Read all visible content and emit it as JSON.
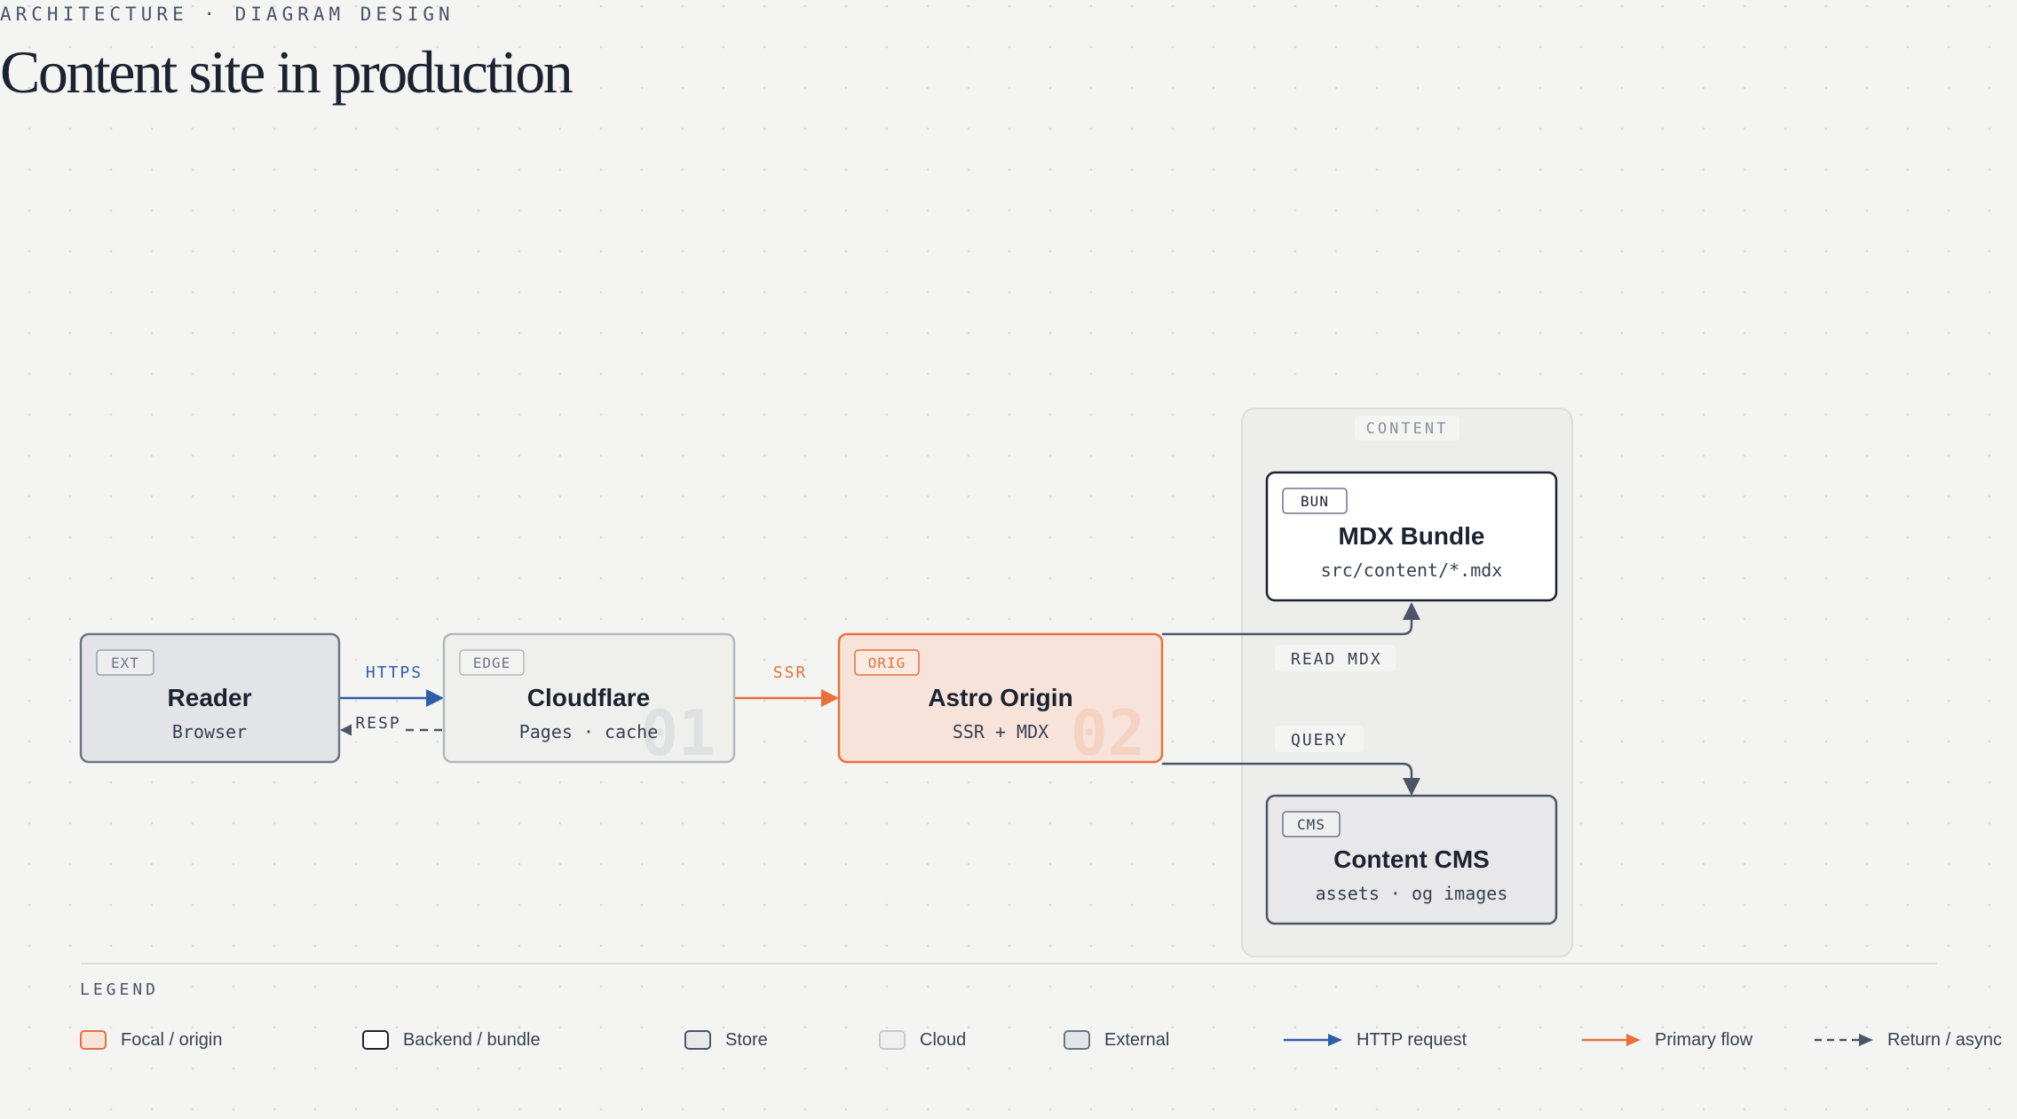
{
  "header": {
    "eyebrow": "ARCHITECTURE · DIAGRAM DESIGN",
    "title": "Content site in production"
  },
  "group": {
    "label": "CONTENT"
  },
  "nodes": {
    "reader": {
      "tag": "EXT",
      "title": "Reader",
      "subtitle": "Browser"
    },
    "cloudflare": {
      "tag": "EDGE",
      "title": "Cloudflare",
      "subtitle": "Pages · cache",
      "number": "01"
    },
    "astro": {
      "tag": "ORIG",
      "title": "Astro Origin",
      "subtitle": "SSR + MDX",
      "number": "02"
    },
    "mdx": {
      "tag": "BUN",
      "title": "MDX Bundle",
      "subtitle": "src/content/*.mdx"
    },
    "cms": {
      "tag": "CMS",
      "title": "Content CMS",
      "subtitle": "assets · og images"
    }
  },
  "edges": {
    "https": "HTTPS",
    "resp": "RESP",
    "ssr": "SSR",
    "read_mdx": "READ MDX",
    "query": "QUERY"
  },
  "legend": {
    "title": "LEGEND",
    "items": {
      "focal": "Focal / origin",
      "backend": "Backend / bundle",
      "store": "Store",
      "cloud": "Cloud",
      "external": "External",
      "http": "HTTP request",
      "primary": "Primary flow",
      "return": "Return / async"
    }
  },
  "colors": {
    "accent": "#e8703a",
    "http_blue": "#2f5ea6",
    "slate": "#4b5567"
  }
}
